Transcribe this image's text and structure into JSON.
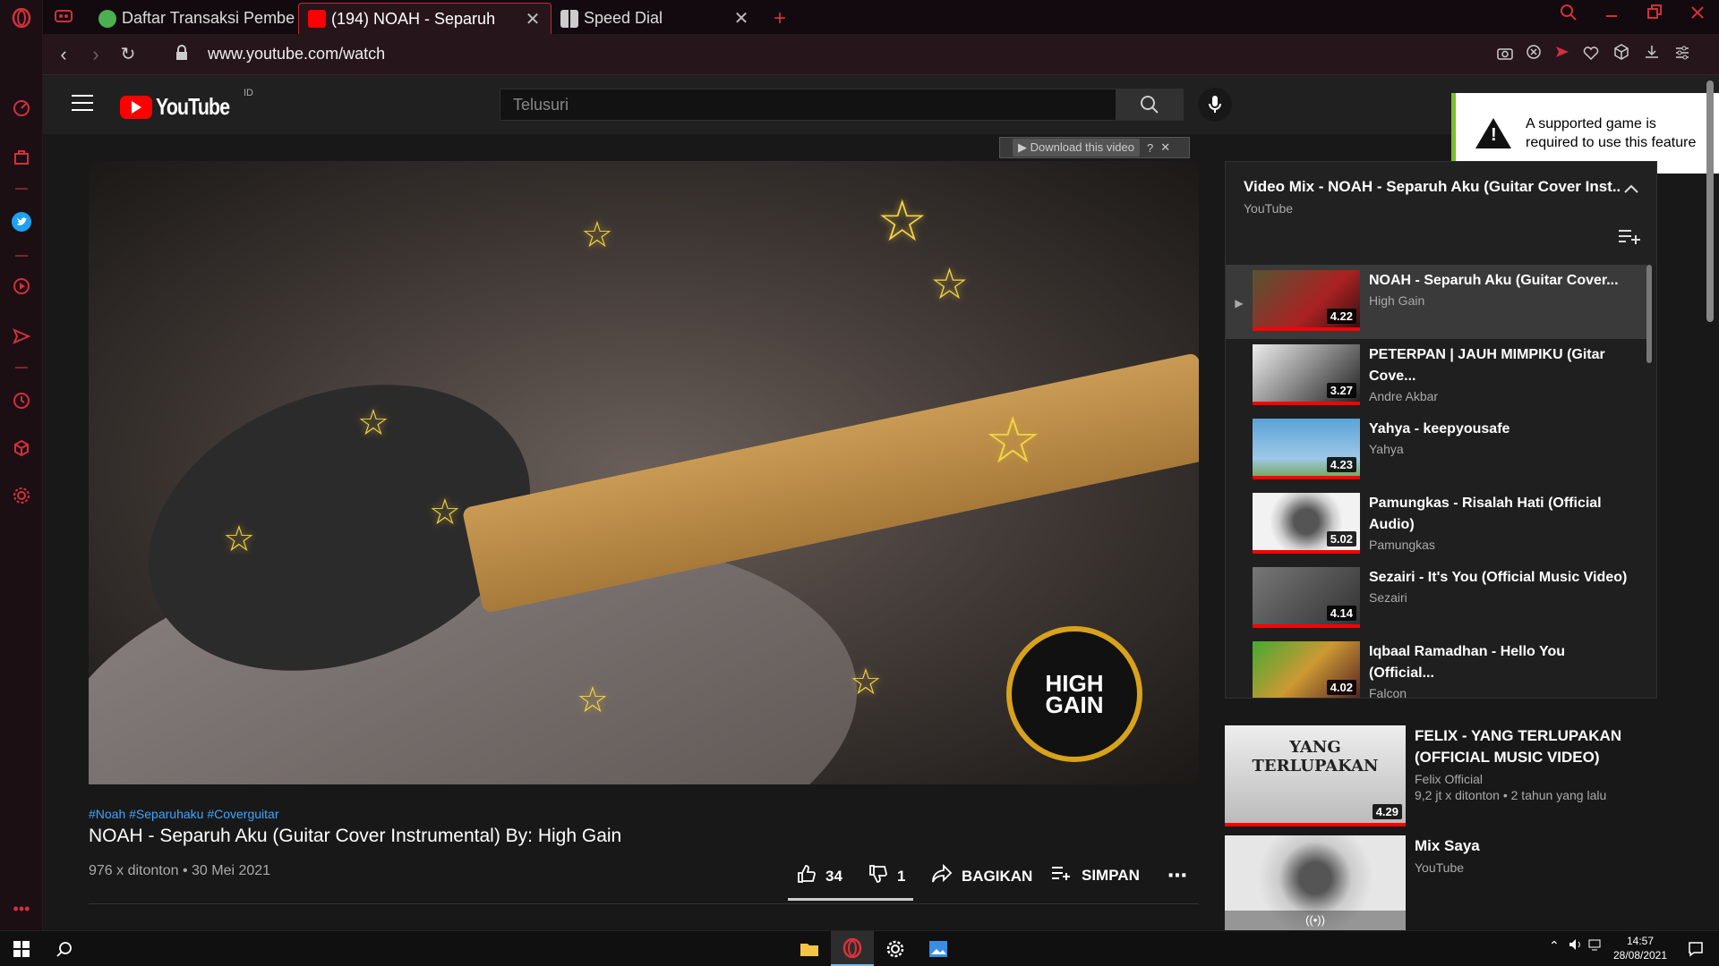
{
  "browser": {
    "tabs": [
      {
        "label": "Daftar Transaksi Pembe",
        "close": "✕"
      },
      {
        "label": "(194) NOAH - Separuh",
        "close": "✕"
      },
      {
        "label": "Speed Dial",
        "close": "✕"
      }
    ],
    "new_tab": "+",
    "url": "www.youtube.com/watch"
  },
  "youtube": {
    "logo_text": "YouTube",
    "country": "ID",
    "search_placeholder": "Telusuri"
  },
  "notice": {
    "text": "A supported game is required to use this feature",
    "icon": "!"
  },
  "download_bar": {
    "label": "Download this video",
    "help": "?",
    "close": "✕"
  },
  "video": {
    "badge": "HIGH GAIN",
    "tags": "#Noah #Separuhaku #Coverguitar",
    "title": "NOAH - Separuh Aku (Guitar Cover Instrumental) By: High Gain",
    "meta": "976 x ditonton • 30 Mei 2021",
    "likes": "34",
    "dislikes": "1",
    "share": "BAGIKAN",
    "save": "SIMPAN",
    "more": "⋯"
  },
  "playlist": {
    "title": "Video Mix - NOAH - Separuh Aku (Guitar Cover Inst...",
    "channel": "YouTube",
    "items": [
      {
        "marker": "▶",
        "title": "NOAH - Separuh Aku (Guitar Cover...",
        "channel": "High Gain",
        "duration": "4.22"
      },
      {
        "marker": "",
        "title": "PETERPAN | JAUH MIMPIKU (Gitar Cove...",
        "channel": "Andre Akbar",
        "duration": "3.27"
      },
      {
        "marker": "",
        "title": "Yahya - keepyousafe",
        "channel": "Yahya",
        "duration": "4.23"
      },
      {
        "marker": "",
        "title": "Pamungkas - Risalah Hati (Official Audio)",
        "channel": "Pamungkas",
        "duration": "5.02"
      },
      {
        "marker": "",
        "title": "Sezairi - It's You (Official Music Video)",
        "channel": "Sezairi",
        "duration": "4.14"
      },
      {
        "marker": "",
        "title": "Iqbaal Ramadhan - Hello You (Official...",
        "channel": "Falcon",
        "duration": "4.02"
      }
    ]
  },
  "recommended": [
    {
      "thumb_text": "YANG TERLUPAKAN",
      "title": "FELIX - YANG TERLUPAKAN (OFFICIAL MUSIC VIDEO)",
      "channel": "Felix Official",
      "meta": "9,2 jt x ditonton • 2 tahun yang lalu",
      "duration": "4.29"
    },
    {
      "thumb_text": "((•))",
      "title": "Mix Saya",
      "channel": "YouTube",
      "meta": ""
    }
  ],
  "taskbar": {
    "time": "14:57",
    "date": "28/08/2021"
  },
  "colors": {
    "accent": "#ff0000",
    "opera": "#d2303a",
    "link": "#3ea6ff"
  }
}
